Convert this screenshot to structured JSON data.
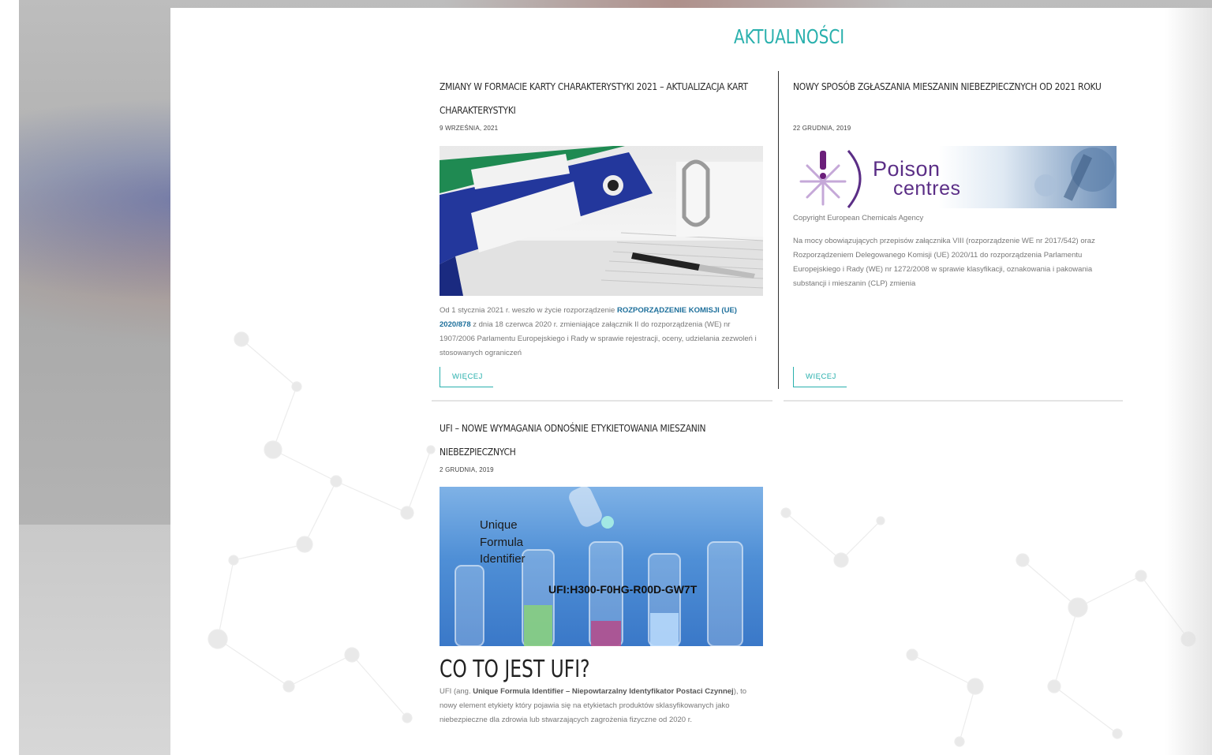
{
  "section_heading": "AKTUALNOŚCI",
  "colors": {
    "accent": "#29b0ad",
    "link": "#1d6f9b"
  },
  "posts": [
    {
      "title_line1": "ZMIANY W FORMACIE KARTY CHARAKTERYSTYKI 2021 – AKTUALIZACJA KART",
      "title_line2": "CHARAKTERYSTYKI",
      "date": "9 WRZEŚNIA, 2021",
      "image": "binders-and-documents",
      "excerpt_before_link": "Od 1 stycznia 2021 r. weszło w życie rozporządzenie ",
      "excerpt_link": "ROZPORZĄDZENIE KOMISJI (UE) 2020/878",
      "excerpt_after_link": " z dnia 18 czerwca 2020 r. zmieniające załącznik II do rozporządzenia (WE) nr 1907/2006 Parlamentu Europejskiego i Rady w sprawie rejestracji, oceny, udzielania zezwoleń i stosowanych ograniczeń",
      "more_label": "WIĘCEJ"
    },
    {
      "title_line1": "NOWY SPOSÓB ZGŁASZANIA MIESZANIN NIEBEZPIECZNYCH OD 2021 ROKU",
      "date": "22 GRUDNIA, 2019",
      "image": "poison-centres-logo",
      "image_text_1": "Poison",
      "image_text_2": "centres",
      "caption": "Copyright European Chemicals Agency",
      "excerpt": "Na mocy obowiązujących przepisów załącznika VIII (rozporządzenie WE nr 2017/542) oraz Rozporządzeniem Delegowanego Komisji (UE) 2020/11 do rozporządzenia Parlamentu Europejskiego i Rady (WE) nr 1272/2008 w sprawie klasyfikacji, oznakowania i pakowania substancji i mieszanin (CLP) zmienia",
      "more_label": "WIĘCEJ"
    },
    {
      "title_line1": "UFI – NOWE WYMAGANIA ODNOŚNIE ETYKIETOWANIA MIESZANIN",
      "title_line2": "NIEBEZPIECZNYCH",
      "date": "2 GRUDNIA, 2019",
      "image": "test-tubes",
      "image_text_1": "Unique",
      "image_text_2": "Formula",
      "image_text_3": "Identifier",
      "image_code": "UFI:H300-F0HG-R00D-GW7T",
      "subheading": "CO TO JEST UFI?",
      "excerpt_prefix": "UFI (ang. ",
      "excerpt_bold": "Unique Formula Identifier – Niepowtarzalny Identyfikator Postaci Czynnej",
      "excerpt_suffix": "), to nowy element etykiety który pojawia się na etykietach produktów sklasyfikowanych jako niebezpieczne dla zdrowia lub stwarzających zagrożenia fizyczne od 2020 r."
    }
  ]
}
